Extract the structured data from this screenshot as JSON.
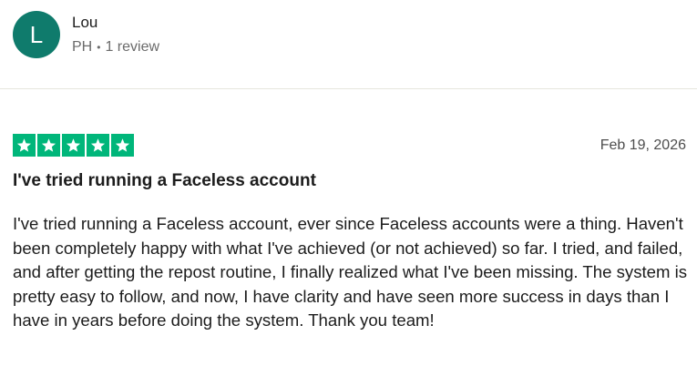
{
  "reviewer": {
    "initial": "L",
    "name": "Lou",
    "country": "PH",
    "separator": "•",
    "review_count": "1 review",
    "avatar_color": "#0f7b6c"
  },
  "review": {
    "rating": 5,
    "max_rating": 5,
    "star_color": "#00b67a",
    "date": "Feb 19, 2026",
    "title": "I've tried running a Faceless account",
    "body": "I've tried running a Faceless account, ever since Faceless accounts were a thing. Haven't been completely happy with what I've achieved (or not achieved) so far. I tried, and failed, and after getting the repost routine, I finally realized what I've been missing. The system is pretty easy to follow, and now, I have clarity and have seen more success in days than I have in years before doing the system. Thank you team!"
  }
}
